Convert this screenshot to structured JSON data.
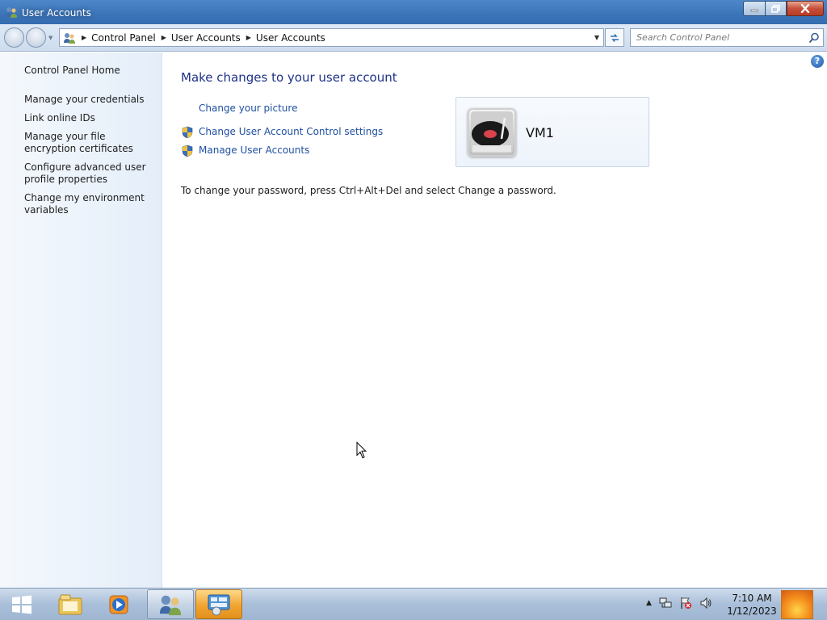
{
  "window": {
    "title": "User Accounts",
    "buttons": {
      "minimize_icon": "minimize-icon",
      "maximize_icon": "restore-icon",
      "close_icon": "close-icon"
    }
  },
  "navigation": {
    "breadcrumb": [
      "Control Panel",
      "User Accounts",
      "User Accounts"
    ],
    "search_placeholder": "Search Control Panel"
  },
  "sidebar": {
    "home": "Control Panel Home",
    "items": [
      {
        "label": "Manage your credentials"
      },
      {
        "label": "Link online IDs"
      },
      {
        "label": "Manage your file encryption certificates"
      },
      {
        "label": "Configure advanced user profile properties"
      },
      {
        "label": "Change my environment variables"
      }
    ]
  },
  "main": {
    "heading": "Make changes to your user account",
    "tasks": [
      {
        "label": "Change your picture",
        "shield": false
      },
      {
        "label": "Change User Account Control settings",
        "shield": true
      },
      {
        "label": "Manage User Accounts",
        "shield": true
      }
    ],
    "password_note": "To change your password, press Ctrl+Alt+Del and select Change a password.",
    "user": {
      "name": "VM1",
      "picture_icon": "turntable-icon"
    },
    "help_glyph": "?"
  },
  "taskbar": {
    "clock_time": "7:10 AM",
    "clock_date": "1/12/2023",
    "pinned": [
      "windows-explorer-icon",
      "media-player-icon",
      "user-accounts-icon",
      "control-panel-icon"
    ]
  },
  "colors": {
    "link": "#1e4fa0",
    "heading": "#1e3287",
    "titlebar": "#3b74b8",
    "sidebar": "#e4eef9"
  }
}
